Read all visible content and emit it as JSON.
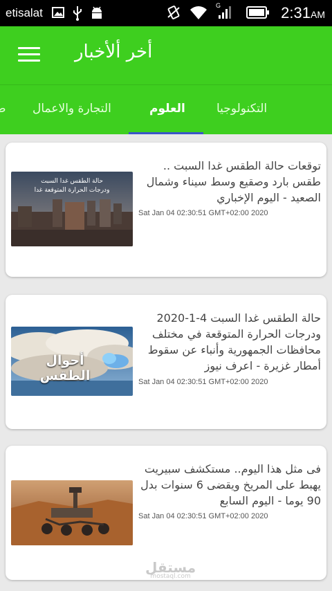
{
  "status_bar": {
    "carrier": "etisalat",
    "time": "2:31",
    "ampm": "AM",
    "signal_label": "G"
  },
  "app_bar": {
    "title": "أخر ألأخبار"
  },
  "tabs": [
    {
      "label": "صحة"
    },
    {
      "label": "التكنولوجيا"
    },
    {
      "label": "العلوم"
    },
    {
      "label": "التجارة والاعمال"
    }
  ],
  "articles": [
    {
      "title": "توقعات حالة الطقس غدا السبت .. طقس بارد وصقيع وسط سيناء وشمال الصعيد - اليوم الإخباري",
      "date": "Sat Jan 04 02:30:51 GMT+02:00 2020",
      "image_text": [
        "حالة الطقس غدا السبت",
        "ودرجات الحرارة المتوقعة غدا"
      ]
    },
    {
      "title": "حالة الطقس غدا السبت 4-1-2020 ودرجات الحرارة المتوقعة في مختلف محافظات الجمهورية وأنباء عن سقوط أمطار غزيرة - اعرف نيوز",
      "date": "Sat Jan 04 02:30:51 GMT+02:00 2020",
      "image_text": [
        "أحوال الطقس"
      ]
    },
    {
      "title": "فى مثل هذا اليوم.. مستكشف سبيريت يهبط على المريخ ويقضى 6 سنوات بدل 90 يوما - اليوم السابع",
      "date": "Sat Jan 04 02:30:51 GMT+02:00 2020",
      "image_text": []
    }
  ],
  "watermark": {
    "text": "مستقل",
    "sub": "mostaql.com"
  },
  "colors": {
    "primary": "#3ecf1f",
    "indicator": "#3a55c8",
    "background": "#e9e9e9"
  }
}
